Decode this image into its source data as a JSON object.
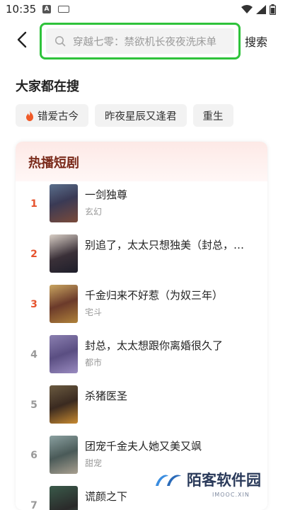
{
  "status_bar": {
    "time": "10:35",
    "notif_a": "A"
  },
  "search": {
    "placeholder": "穿越七零：禁欲机长夜夜洗床单",
    "button": "搜索"
  },
  "hot_search": {
    "title": "大家都在搜",
    "chips": [
      "错爱古今",
      "昨夜星辰又逢君",
      "重生"
    ]
  },
  "ranking": {
    "title": "热播短剧",
    "items": [
      {
        "rank": "1",
        "title": "一剑独尊",
        "tag": "玄幻"
      },
      {
        "rank": "2",
        "title": "别追了，太太只想独美（封总，…",
        "tag": ""
      },
      {
        "rank": "3",
        "title": "千金归来不好惹（为奴三年）",
        "tag": "宅斗"
      },
      {
        "rank": "4",
        "title": "封总，太太想跟你离婚很久了",
        "tag": "都市"
      },
      {
        "rank": "5",
        "title": "杀猪医圣",
        "tag": ""
      },
      {
        "rank": "6",
        "title": "团宠千金夫人她又美又飒",
        "tag": "甜宠"
      },
      {
        "rank": "7",
        "title": "谎颜之下",
        "tag": ""
      }
    ]
  },
  "watermark": {
    "text": "陌客软件园",
    "sub": "IMOOC.XIN"
  },
  "colors": {
    "accent_green": "#2fc33b",
    "rank_top": "#e6532e",
    "panel_title": "#7a2a1a"
  }
}
